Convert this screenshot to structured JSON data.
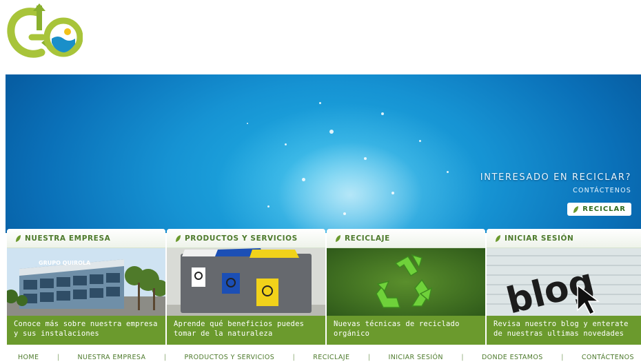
{
  "colors": {
    "brand_green": "#6b9a2d",
    "title_green": "#4d7a2c",
    "sea_blue": "#1693d3"
  },
  "logo": {
    "icon": "recycle-globe-logo-icon"
  },
  "hero": {
    "question": "INTERESADO EN RECICLAR?",
    "contact": "CONTÁCTENOS",
    "button_label": "RECICLAR"
  },
  "cards": [
    {
      "title": "NUESTRA EMPRESA",
      "caption": "Conoce más sobre nuestra empresa y sus instalaciones",
      "building_sign": "GRUPO QUIROLA"
    },
    {
      "title": "PRODUCTOS Y SERVICIOS",
      "caption": "Aprende qué beneficios puedes tomar de la naturaleza"
    },
    {
      "title": "RECICLAJE",
      "caption": "Nuevas técnicas de reciclado orgánico"
    },
    {
      "title": "INICIAR SESIÓN",
      "caption": "Revisa nuestro blog y enterate de nuestras ultimas novedades",
      "image_text": "blog"
    }
  ],
  "footer_nav": [
    "HOME",
    "NUESTRA EMPRESA",
    "PRODUCTOS Y SERVICIOS",
    "RECICLAJE",
    "INICIAR SESIÓN",
    "DONDE ESTAMOS",
    "CONTÁCTENOS"
  ]
}
